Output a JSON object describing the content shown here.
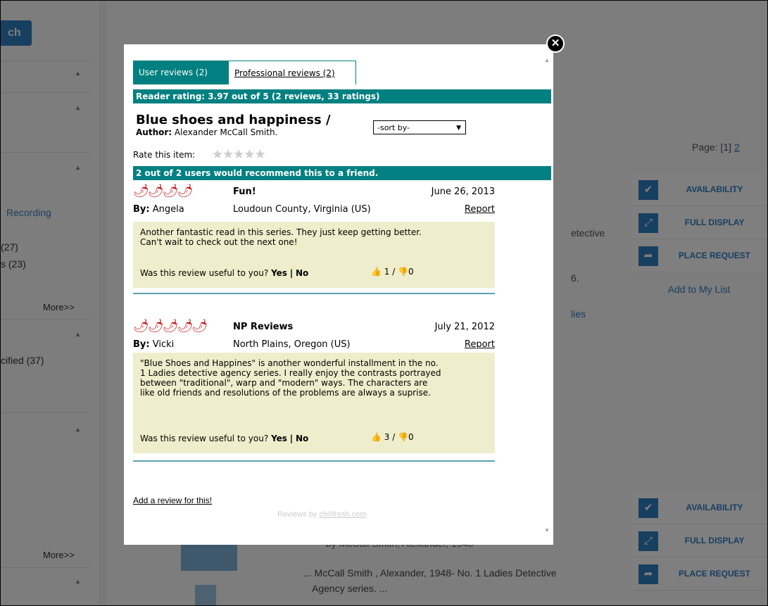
{
  "background": {
    "search_btn": "ch",
    "left_items": {
      "recording": "Recording",
      "count27": "(27)",
      "count23": "s (23)",
      "more1": "More>>",
      "ified": "cified (37)",
      "more2": "More>>"
    },
    "pager": {
      "label": "Page:",
      "current": "[1]",
      "next": "2"
    },
    "actions1": [
      "AVAILABILITY",
      "FULL DISPLAY",
      "PLACE REQUEST"
    ],
    "add_to_list": "Add to My List",
    "detective": "etective",
    "six": "6.",
    "dies": "lies",
    "actions2": [
      "AVAILABILITY",
      "FULL DISPLAY",
      "PLACE REQUEST"
    ],
    "result2_line1": "by McCall Smith, Alexander, 1948",
    "result2_line2": "... McCall Smith , Alexander, 1948- No. 1 Ladies Detective",
    "result2_line3": "Agency series. ..."
  },
  "modal": {
    "close_icon": "close-icon",
    "tabs": {
      "user": "User reviews (2)",
      "professional": "Professional reviews (2)"
    },
    "reader_rating": "Reader rating: 3.97 out of 5 (2 reviews, 33 ratings)",
    "title": "Blue shoes and happiness /",
    "author_label": "Author:",
    "author": "Alexander McCall Smith.",
    "sort_label": "-sort by-",
    "rate_label": "Rate this item:",
    "recommend": "2 out of 2 users would recommend this to a friend.",
    "reviews": [
      {
        "peppers": 4,
        "title": "Fun!",
        "date": "June 26, 2013",
        "by_label": "By:",
        "by": "Angela",
        "location": "Loudoun County, Virginia (US)",
        "report": "Report",
        "text": "Another fantastic read in this series. They just keep getting better. Can't wait to check out the next one!",
        "useful_q": "Was this review useful to you?",
        "yes": "Yes",
        "sep": "|",
        "no": "No",
        "up": "1",
        "down": "0"
      },
      {
        "peppers": 5,
        "title": "NP Reviews",
        "date": "July 21, 2012",
        "by_label": "By:",
        "by": "Vicki",
        "location": "North Plains, Oregon (US)",
        "report": "Report",
        "text": "\"Blue Shoes and Happines\" is another wonderful installment in the no. 1 Ladies detective agency series. I really enjoy the contrasts portrayed between \"traditional\", warp and \"modern\" ways. The characters are like old friends and resolutions of the problems are always a suprise.",
        "useful_q": "Was this review useful to you?",
        "yes": "Yes",
        "sep": "|",
        "no": "No",
        "up": "3",
        "down": "0"
      }
    ],
    "add_review": "Add a review for this!",
    "powered_prefix": "Reviews by",
    "powered_link": "chilifresh.com"
  }
}
